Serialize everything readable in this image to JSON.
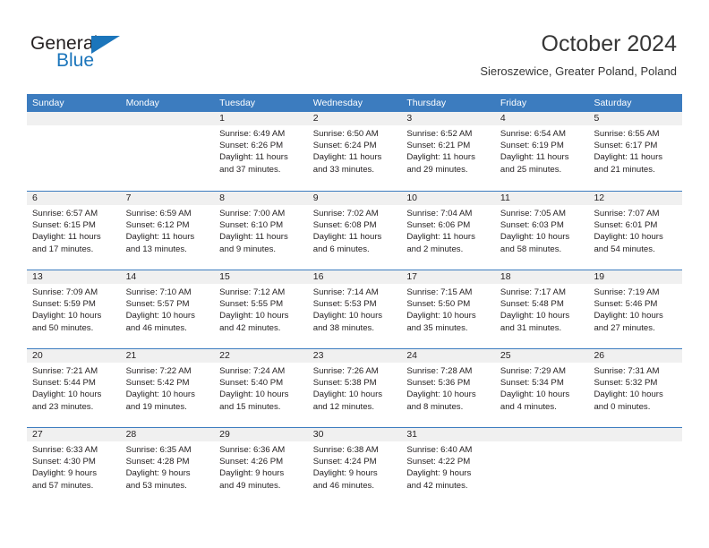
{
  "brand": {
    "word_one": "General",
    "word_two": "Blue",
    "triangle_icon": "triangle-icon",
    "accent_color": "#1b75bb"
  },
  "header": {
    "title": "October 2024",
    "subtitle": "Sieroszewice, Greater Poland, Poland"
  },
  "calendar": {
    "header_color": "#3c7cbf",
    "date_band_color": "#f0f0f0",
    "weekdays": [
      "Sunday",
      "Monday",
      "Tuesday",
      "Wednesday",
      "Thursday",
      "Friday",
      "Saturday"
    ],
    "weeks": [
      [
        {
          "day": "",
          "lines": []
        },
        {
          "day": "",
          "lines": []
        },
        {
          "day": "1",
          "lines": [
            "Sunrise: 6:49 AM",
            "Sunset: 6:26 PM",
            "Daylight: 11 hours",
            "and 37 minutes."
          ]
        },
        {
          "day": "2",
          "lines": [
            "Sunrise: 6:50 AM",
            "Sunset: 6:24 PM",
            "Daylight: 11 hours",
            "and 33 minutes."
          ]
        },
        {
          "day": "3",
          "lines": [
            "Sunrise: 6:52 AM",
            "Sunset: 6:21 PM",
            "Daylight: 11 hours",
            "and 29 minutes."
          ]
        },
        {
          "day": "4",
          "lines": [
            "Sunrise: 6:54 AM",
            "Sunset: 6:19 PM",
            "Daylight: 11 hours",
            "and 25 minutes."
          ]
        },
        {
          "day": "5",
          "lines": [
            "Sunrise: 6:55 AM",
            "Sunset: 6:17 PM",
            "Daylight: 11 hours",
            "and 21 minutes."
          ]
        }
      ],
      [
        {
          "day": "6",
          "lines": [
            "Sunrise: 6:57 AM",
            "Sunset: 6:15 PM",
            "Daylight: 11 hours",
            "and 17 minutes."
          ]
        },
        {
          "day": "7",
          "lines": [
            "Sunrise: 6:59 AM",
            "Sunset: 6:12 PM",
            "Daylight: 11 hours",
            "and 13 minutes."
          ]
        },
        {
          "day": "8",
          "lines": [
            "Sunrise: 7:00 AM",
            "Sunset: 6:10 PM",
            "Daylight: 11 hours",
            "and 9 minutes."
          ]
        },
        {
          "day": "9",
          "lines": [
            "Sunrise: 7:02 AM",
            "Sunset: 6:08 PM",
            "Daylight: 11 hours",
            "and 6 minutes."
          ]
        },
        {
          "day": "10",
          "lines": [
            "Sunrise: 7:04 AM",
            "Sunset: 6:06 PM",
            "Daylight: 11 hours",
            "and 2 minutes."
          ]
        },
        {
          "day": "11",
          "lines": [
            "Sunrise: 7:05 AM",
            "Sunset: 6:03 PM",
            "Daylight: 10 hours",
            "and 58 minutes."
          ]
        },
        {
          "day": "12",
          "lines": [
            "Sunrise: 7:07 AM",
            "Sunset: 6:01 PM",
            "Daylight: 10 hours",
            "and 54 minutes."
          ]
        }
      ],
      [
        {
          "day": "13",
          "lines": [
            "Sunrise: 7:09 AM",
            "Sunset: 5:59 PM",
            "Daylight: 10 hours",
            "and 50 minutes."
          ]
        },
        {
          "day": "14",
          "lines": [
            "Sunrise: 7:10 AM",
            "Sunset: 5:57 PM",
            "Daylight: 10 hours",
            "and 46 minutes."
          ]
        },
        {
          "day": "15",
          "lines": [
            "Sunrise: 7:12 AM",
            "Sunset: 5:55 PM",
            "Daylight: 10 hours",
            "and 42 minutes."
          ]
        },
        {
          "day": "16",
          "lines": [
            "Sunrise: 7:14 AM",
            "Sunset: 5:53 PM",
            "Daylight: 10 hours",
            "and 38 minutes."
          ]
        },
        {
          "day": "17",
          "lines": [
            "Sunrise: 7:15 AM",
            "Sunset: 5:50 PM",
            "Daylight: 10 hours",
            "and 35 minutes."
          ]
        },
        {
          "day": "18",
          "lines": [
            "Sunrise: 7:17 AM",
            "Sunset: 5:48 PM",
            "Daylight: 10 hours",
            "and 31 minutes."
          ]
        },
        {
          "day": "19",
          "lines": [
            "Sunrise: 7:19 AM",
            "Sunset: 5:46 PM",
            "Daylight: 10 hours",
            "and 27 minutes."
          ]
        }
      ],
      [
        {
          "day": "20",
          "lines": [
            "Sunrise: 7:21 AM",
            "Sunset: 5:44 PM",
            "Daylight: 10 hours",
            "and 23 minutes."
          ]
        },
        {
          "day": "21",
          "lines": [
            "Sunrise: 7:22 AM",
            "Sunset: 5:42 PM",
            "Daylight: 10 hours",
            "and 19 minutes."
          ]
        },
        {
          "day": "22",
          "lines": [
            "Sunrise: 7:24 AM",
            "Sunset: 5:40 PM",
            "Daylight: 10 hours",
            "and 15 minutes."
          ]
        },
        {
          "day": "23",
          "lines": [
            "Sunrise: 7:26 AM",
            "Sunset: 5:38 PM",
            "Daylight: 10 hours",
            "and 12 minutes."
          ]
        },
        {
          "day": "24",
          "lines": [
            "Sunrise: 7:28 AM",
            "Sunset: 5:36 PM",
            "Daylight: 10 hours",
            "and 8 minutes."
          ]
        },
        {
          "day": "25",
          "lines": [
            "Sunrise: 7:29 AM",
            "Sunset: 5:34 PM",
            "Daylight: 10 hours",
            "and 4 minutes."
          ]
        },
        {
          "day": "26",
          "lines": [
            "Sunrise: 7:31 AM",
            "Sunset: 5:32 PM",
            "Daylight: 10 hours",
            "and 0 minutes."
          ]
        }
      ],
      [
        {
          "day": "27",
          "lines": [
            "Sunrise: 6:33 AM",
            "Sunset: 4:30 PM",
            "Daylight: 9 hours",
            "and 57 minutes."
          ]
        },
        {
          "day": "28",
          "lines": [
            "Sunrise: 6:35 AM",
            "Sunset: 4:28 PM",
            "Daylight: 9 hours",
            "and 53 minutes."
          ]
        },
        {
          "day": "29",
          "lines": [
            "Sunrise: 6:36 AM",
            "Sunset: 4:26 PM",
            "Daylight: 9 hours",
            "and 49 minutes."
          ]
        },
        {
          "day": "30",
          "lines": [
            "Sunrise: 6:38 AM",
            "Sunset: 4:24 PM",
            "Daylight: 9 hours",
            "and 46 minutes."
          ]
        },
        {
          "day": "31",
          "lines": [
            "Sunrise: 6:40 AM",
            "Sunset: 4:22 PM",
            "Daylight: 9 hours",
            "and 42 minutes."
          ]
        },
        {
          "day": "",
          "lines": []
        },
        {
          "day": "",
          "lines": []
        }
      ]
    ]
  }
}
